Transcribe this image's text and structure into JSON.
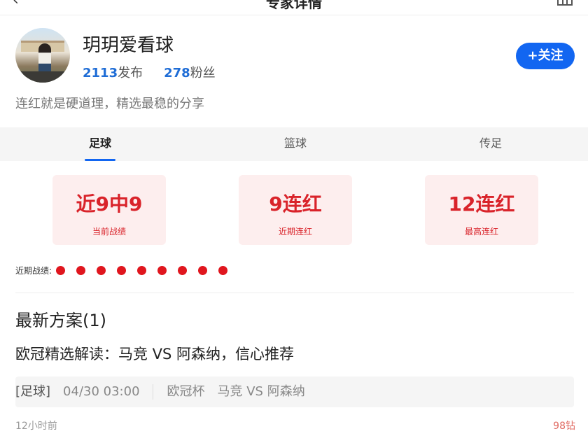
{
  "topbar": {
    "title": "专家详情",
    "back_icon": "back-arrow-icon",
    "tool_icon": "shop-icon"
  },
  "profile": {
    "name": "玥玥爱看球",
    "posts_count": "2113",
    "posts_label": "发布",
    "fans_count": "278",
    "fans_label": "粉丝",
    "follow_label": "+关注",
    "bio": "连红就是硬道理，精选最稳的分享"
  },
  "tabs": [
    {
      "label": "足球",
      "active": true
    },
    {
      "label": "篮球",
      "active": false
    },
    {
      "label": "传足",
      "active": false
    }
  ],
  "stats": [
    {
      "value": "近9中9",
      "label": "当前战绩"
    },
    {
      "value": "9连红",
      "label": "近期连红"
    },
    {
      "value": "12连红",
      "label": "最高连红"
    }
  ],
  "recent": {
    "label": "近期战绩:",
    "results": [
      "win",
      "win",
      "win",
      "win",
      "win",
      "win",
      "win",
      "win",
      "win"
    ]
  },
  "plans": {
    "title": "最新方案(1)",
    "items": [
      {
        "title": "欧冠精选解读：马竞 VS 阿森纳，信心推荐",
        "tag": "[足球]",
        "time": "04/30 03:00",
        "league": "欧冠杯",
        "match": "马竞 VS 阿森纳",
        "posted": "12小时前",
        "price": "98钻"
      }
    ]
  },
  "colors": {
    "accent": "#1266f1",
    "red": "#d9232a",
    "card_bg": "#fdeeee"
  }
}
